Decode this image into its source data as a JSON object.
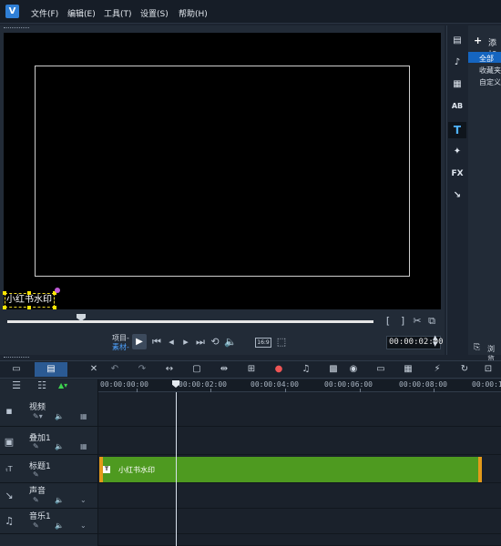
{
  "menu": [
    "文件(F)",
    "编辑(E)",
    "工具(T)",
    "设置(S)",
    "帮助(H)"
  ],
  "preview": {
    "watermark_text": "小红书水印",
    "mode_project": "项目-",
    "mode_clip": "素材-",
    "timecode": "00:00:02:00",
    "scrub_position": 0.2
  },
  "library": {
    "add_label": "添加",
    "items": [
      "全部",
      "收藏夹",
      "自定义"
    ],
    "browse_label": "浏览"
  },
  "side_tabs": [
    "media",
    "instant-project",
    "transition",
    "title-a",
    "T",
    "filter",
    "FX",
    "path"
  ],
  "timeline": {
    "ruler": [
      "00:00:00:00",
      "00:00:02:00",
      "00:00:04:00",
      "00:00:06:00",
      "00:00:08:00",
      "00:00:10:"
    ],
    "tracks": [
      {
        "name": "视频"
      },
      {
        "name": "叠加1"
      },
      {
        "name": "标题1"
      },
      {
        "name": "声音"
      },
      {
        "name": "音乐1"
      }
    ],
    "title_clip_label": "小红书水印"
  },
  "colors": {
    "clip_green": "#4e9a20",
    "clip_border": "#e39a1a",
    "accent": "#2f7fd6"
  }
}
